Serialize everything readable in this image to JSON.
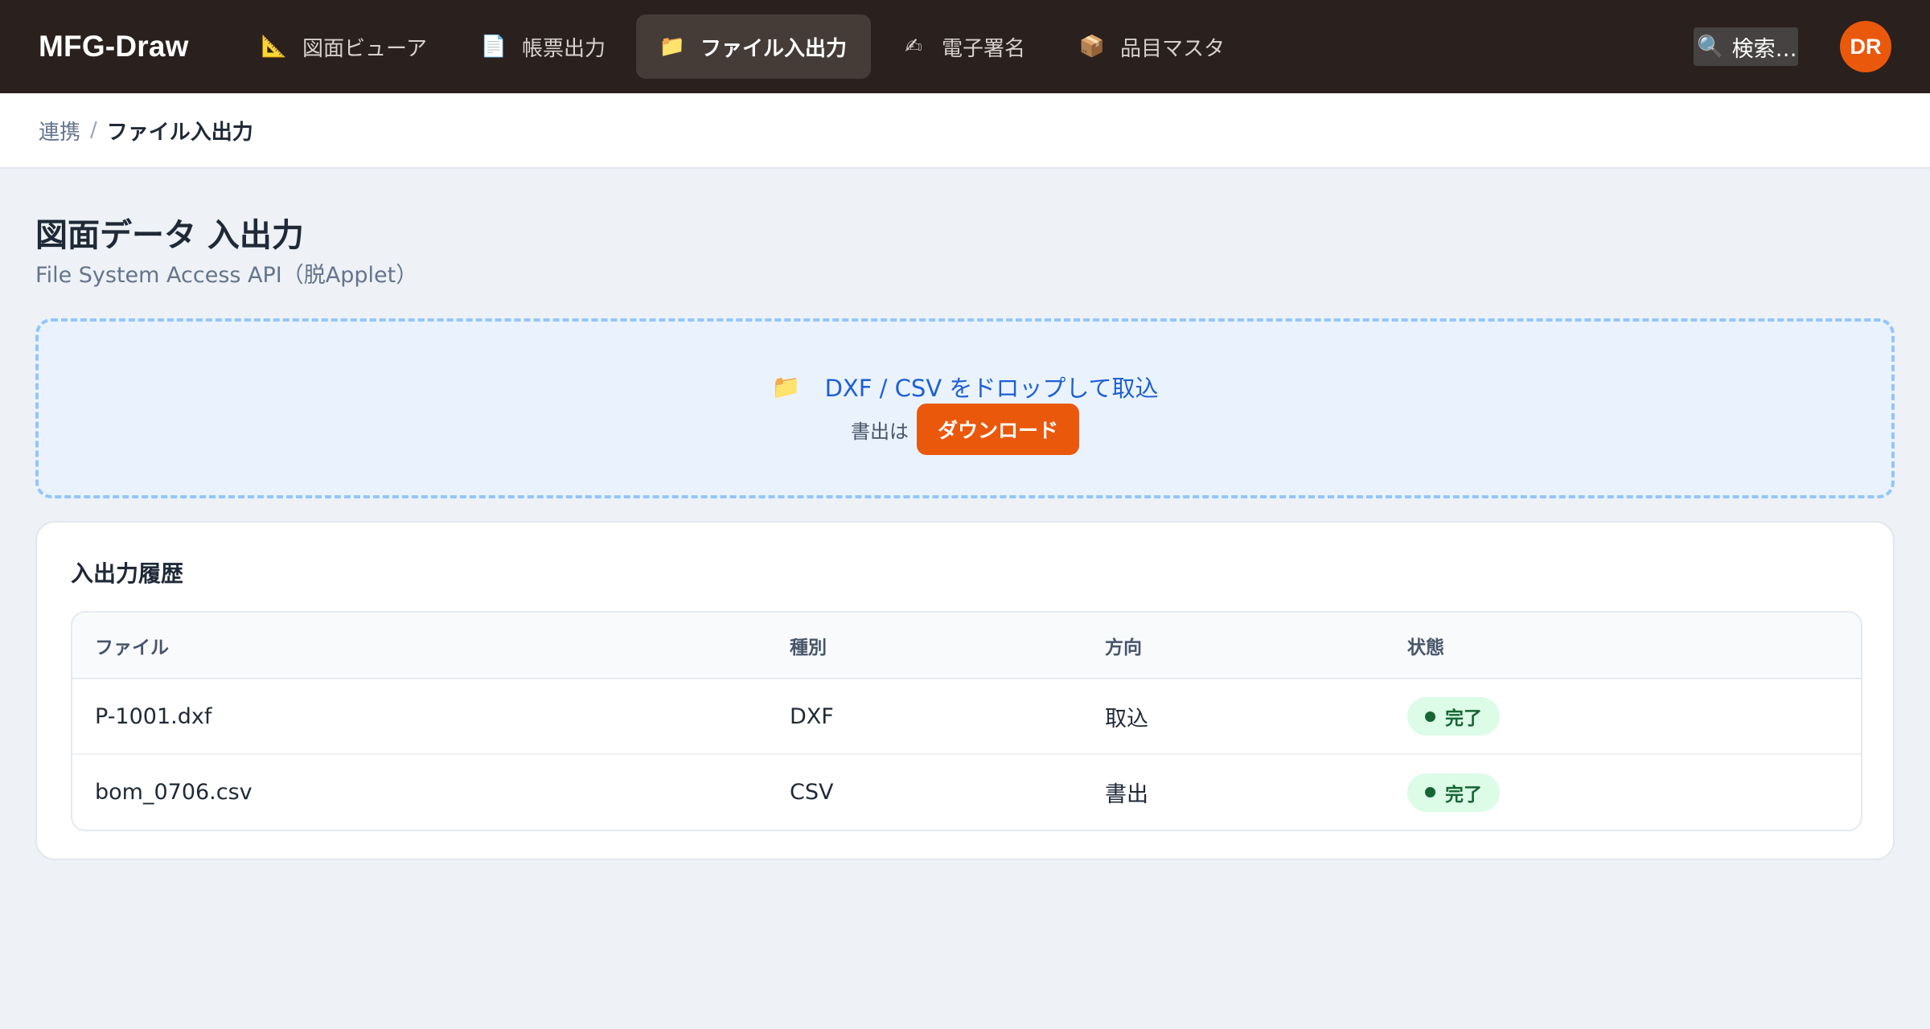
{
  "app": {
    "brand": "MFG-Draw",
    "nav": [
      {
        "icon": "triangle-ruler-icon",
        "glyph": "📐",
        "label": "図面ビューア",
        "active": false
      },
      {
        "icon": "document-icon",
        "glyph": "📄",
        "label": "帳票出力",
        "active": false
      },
      {
        "icon": "folder-icon",
        "glyph": "📁",
        "label": "ファイル入出力",
        "active": true
      },
      {
        "icon": "writing-hand-icon",
        "glyph": "✍",
        "label": "電子署名",
        "active": false
      },
      {
        "icon": "package-icon",
        "glyph": "📦",
        "label": "品目マスタ",
        "active": false
      }
    ],
    "search": {
      "icon": "search-icon",
      "glyph": "🔍",
      "label": "検索…"
    },
    "avatar": "DR"
  },
  "breadcrumb": {
    "parent": "連携",
    "separator": "/",
    "current": "ファイル入出力"
  },
  "page": {
    "title": "図面データ 入出力",
    "subtitle": "File System Access API（脱Applet）"
  },
  "dropzone": {
    "icon": "folder-icon",
    "glyph": "📁",
    "text": "DXF / CSV をドロップして取込",
    "export_prefix": "書出は",
    "download_label": "ダウンロード"
  },
  "history": {
    "title": "入出力履歴",
    "columns": [
      "ファイル",
      "種別",
      "方向",
      "状態"
    ],
    "rows": [
      {
        "file": "P-1001.dxf",
        "type": "DXF",
        "direction": "取込",
        "status": "完了"
      },
      {
        "file": "bom_0706.csv",
        "type": "CSV",
        "direction": "書出",
        "status": "完了"
      }
    ]
  },
  "colors": {
    "topbar": "#2a201d",
    "accent": "#ea580c",
    "link": "#1d5fd6",
    "success": "#166534"
  }
}
